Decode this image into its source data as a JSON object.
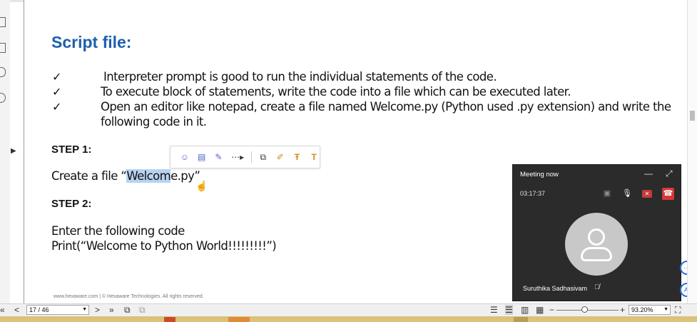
{
  "document": {
    "title": "Script file:",
    "bullets": [
      {
        "check": "✓",
        "text": "Interpreter prompt is good to run the individual statements of the code."
      },
      {
        "check": "✓",
        "text": "To execute  block of statements, write the code into a file which can be executed later."
      },
      {
        "check": "✓",
        "text": "Open an editor like notepad, create a file named Welcome.py (Python used .py extension) and write the",
        "text2": "following code in it."
      }
    ],
    "step1_label": "STEP 1:",
    "step1_line_pre": "Create a file “",
    "step1_line_selected": "Welcom",
    "step1_line_post": "e.py”",
    "step2_label": "STEP 2:",
    "step2_line1": "Enter the following code",
    "step2_line2": "Print(“Welcome to Python World!!!!!!!!!”)",
    "footer": "www.hexaware.com | © Hexaware Technologies. All rights reserved."
  },
  "floating_toolbar": {
    "icons": [
      "comment-icon",
      "note-icon",
      "highlight-pen-icon",
      "more-icon",
      "copy-icon",
      "highlighter-icon",
      "strikethrough-text-icon",
      "text-icon"
    ],
    "more_label": "⋯▸"
  },
  "meeting": {
    "title": "Meeting now",
    "timer": "03:17:37",
    "participant": "Suruthika Sadhasivam"
  },
  "status_bar": {
    "page_indicator": "17 / 46",
    "zoom": "93.20%",
    "zoom_minus": "−",
    "zoom_plus": "+"
  },
  "colors": {
    "title_blue": "#1e5fad",
    "selection": "#b7d3f2",
    "meeting_bg": "#2b2b2b",
    "hangup_red": "#d93737"
  }
}
